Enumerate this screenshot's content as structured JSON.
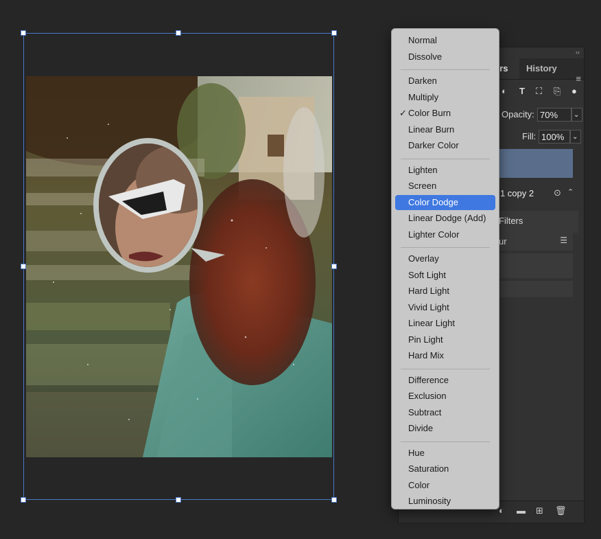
{
  "layers_panel": {
    "tabs": [
      "Layers",
      "History"
    ],
    "visible_tab_text": [
      "ers",
      "History"
    ],
    "opacity_label": "Opacity:",
    "opacity_value": "70%",
    "fill_label": "Fill:",
    "fill_value": "100%",
    "layer_name_visible": "r 1 copy 2",
    "smart_filters_label": "Filters",
    "filter_item_label": "ur",
    "icons": {
      "menu": "panel-menu-icon",
      "filter_adjust": "adjustment-filter-icon",
      "filter_type": "type-filter-icon",
      "filter_shape": "shape-filter-icon",
      "filter_smart": "smart-object-filter-icon",
      "filter_toggle": "filter-toggle-icon"
    },
    "bottom_icons": [
      "adjustment-layer-icon",
      "group-folder-icon",
      "new-layer-icon",
      "delete-icon"
    ]
  },
  "blend_menu": {
    "selected": "Color Dodge",
    "checked": "Color Burn",
    "groups": [
      [
        "Normal",
        "Dissolve"
      ],
      [
        "Darken",
        "Multiply",
        "Color Burn",
        "Linear Burn",
        "Darker Color"
      ],
      [
        "Lighten",
        "Screen",
        "Color Dodge",
        "Linear Dodge (Add)",
        "Lighter Color"
      ],
      [
        "Overlay",
        "Soft Light",
        "Hard Light",
        "Vivid Light",
        "Linear Light",
        "Pin Light",
        "Hard Mix"
      ],
      [
        "Difference",
        "Exclusion",
        "Subtract",
        "Divide"
      ],
      [
        "Hue",
        "Saturation",
        "Color",
        "Luminosity"
      ]
    ]
  },
  "colors": {
    "accent": "#3f78e0",
    "selection_box": "#4a78c8",
    "selected_layer": "#5a6e8c"
  }
}
